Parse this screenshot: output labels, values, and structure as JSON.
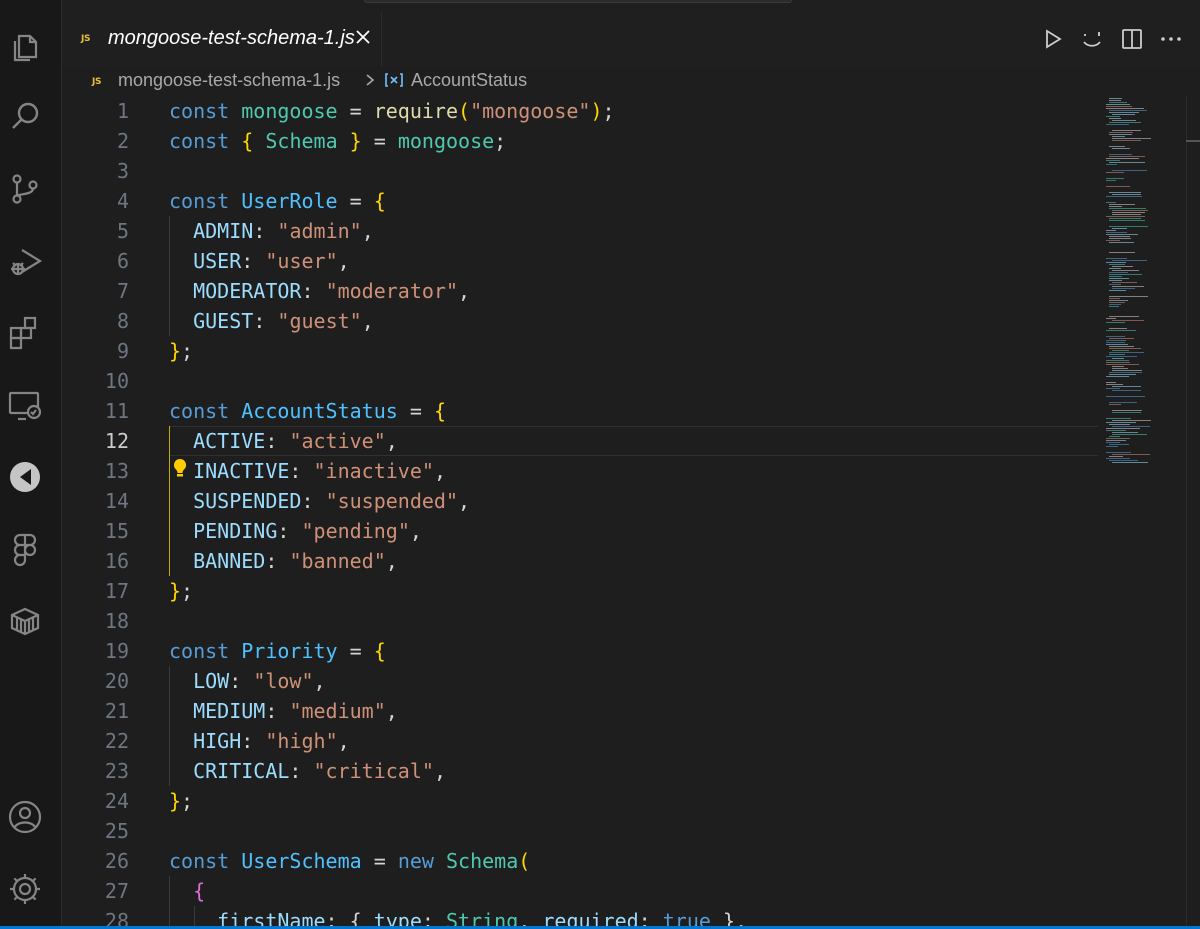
{
  "tab": {
    "file_icon": "JS",
    "title": "mongoose-test-schema-1.js",
    "close_icon": "close-icon"
  },
  "breadcrumb": {
    "file_icon": "JS",
    "file": "mongoose-test-schema-1.js",
    "symbol_icon": "symbol-variable-icon",
    "symbol": "AccountStatus"
  },
  "activity_bar": {
    "items": [
      "explorer-icon",
      "search-icon",
      "source-control-icon",
      "run-debug-icon",
      "extensions-icon",
      "remote-explorer-icon",
      "gitkraken-icon",
      "figma-icon",
      "containers-icon"
    ],
    "bottom": [
      "accounts-icon",
      "manage-gear-icon"
    ]
  },
  "editor_actions": [
    "run-icon",
    "copilot-icon",
    "split-editor-icon",
    "more-actions-icon"
  ],
  "editor": {
    "active_line": 12,
    "lines": [
      {
        "n": "1",
        "t": [
          [
            "kw",
            "const"
          ],
          [
            "p",
            " "
          ],
          [
            "cls",
            "mongoose"
          ],
          [
            "p",
            " = "
          ],
          [
            "fn",
            "require"
          ],
          [
            "b1",
            "("
          ],
          [
            "str",
            "\"mongoose\""
          ],
          [
            "b1",
            ")"
          ],
          [
            "p",
            ";"
          ]
        ]
      },
      {
        "n": "2",
        "t": [
          [
            "kw",
            "const"
          ],
          [
            "p",
            " "
          ],
          [
            "b1",
            "{"
          ],
          [
            "p",
            " "
          ],
          [
            "cls",
            "Schema"
          ],
          [
            "p",
            " "
          ],
          [
            "b1",
            "}"
          ],
          [
            "p",
            " = "
          ],
          [
            "cls",
            "mongoose"
          ],
          [
            "p",
            ";"
          ]
        ]
      },
      {
        "n": "3",
        "t": []
      },
      {
        "n": "4",
        "t": [
          [
            "kw",
            "const"
          ],
          [
            "p",
            " "
          ],
          [
            "var",
            "UserRole"
          ],
          [
            "p",
            " = "
          ],
          [
            "b1",
            "{"
          ]
        ]
      },
      {
        "n": "5",
        "t": [
          [
            "p",
            "  "
          ],
          [
            "prop",
            "ADMIN"
          ],
          [
            "p",
            ": "
          ],
          [
            "str",
            "\"admin\""
          ],
          [
            "p",
            ","
          ]
        ]
      },
      {
        "n": "6",
        "t": [
          [
            "p",
            "  "
          ],
          [
            "prop",
            "USER"
          ],
          [
            "p",
            ": "
          ],
          [
            "str",
            "\"user\""
          ],
          [
            "p",
            ","
          ]
        ]
      },
      {
        "n": "7",
        "t": [
          [
            "p",
            "  "
          ],
          [
            "prop",
            "MODERATOR"
          ],
          [
            "p",
            ": "
          ],
          [
            "str",
            "\"moderator\""
          ],
          [
            "p",
            ","
          ]
        ]
      },
      {
        "n": "8",
        "t": [
          [
            "p",
            "  "
          ],
          [
            "prop",
            "GUEST"
          ],
          [
            "p",
            ": "
          ],
          [
            "str",
            "\"guest\""
          ],
          [
            "p",
            ","
          ]
        ]
      },
      {
        "n": "9",
        "t": [
          [
            "b1",
            "}"
          ],
          [
            "p",
            ";"
          ]
        ]
      },
      {
        "n": "10",
        "t": []
      },
      {
        "n": "11",
        "t": [
          [
            "kw",
            "const"
          ],
          [
            "p",
            " "
          ],
          [
            "var",
            "AccountStatus"
          ],
          [
            "p",
            " = "
          ],
          [
            "b1",
            "{"
          ]
        ]
      },
      {
        "n": "12",
        "t": [
          [
            "p",
            "  "
          ],
          [
            "prop",
            "ACTIVE"
          ],
          [
            "p",
            ": "
          ],
          [
            "str",
            "\"active\""
          ],
          [
            "p",
            ","
          ]
        ]
      },
      {
        "n": "13",
        "t": [
          [
            "p",
            "  "
          ],
          [
            "prop",
            "INACTIVE"
          ],
          [
            "p",
            ": "
          ],
          [
            "str",
            "\"inactive\""
          ],
          [
            "p",
            ","
          ]
        ]
      },
      {
        "n": "14",
        "t": [
          [
            "p",
            "  "
          ],
          [
            "prop",
            "SUSPENDED"
          ],
          [
            "p",
            ": "
          ],
          [
            "str",
            "\"suspended\""
          ],
          [
            "p",
            ","
          ]
        ]
      },
      {
        "n": "15",
        "t": [
          [
            "p",
            "  "
          ],
          [
            "prop",
            "PENDING"
          ],
          [
            "p",
            ": "
          ],
          [
            "str",
            "\"pending\""
          ],
          [
            "p",
            ","
          ]
        ]
      },
      {
        "n": "16",
        "t": [
          [
            "p",
            "  "
          ],
          [
            "prop",
            "BANNED"
          ],
          [
            "p",
            ": "
          ],
          [
            "str",
            "\"banned\""
          ],
          [
            "p",
            ","
          ]
        ]
      },
      {
        "n": "17",
        "t": [
          [
            "b1",
            "}"
          ],
          [
            "p",
            ";"
          ]
        ]
      },
      {
        "n": "18",
        "t": []
      },
      {
        "n": "19",
        "t": [
          [
            "kw",
            "const"
          ],
          [
            "p",
            " "
          ],
          [
            "var",
            "Priority"
          ],
          [
            "p",
            " = "
          ],
          [
            "b1",
            "{"
          ]
        ]
      },
      {
        "n": "20",
        "t": [
          [
            "p",
            "  "
          ],
          [
            "prop",
            "LOW"
          ],
          [
            "p",
            ": "
          ],
          [
            "str",
            "\"low\""
          ],
          [
            "p",
            ","
          ]
        ]
      },
      {
        "n": "21",
        "t": [
          [
            "p",
            "  "
          ],
          [
            "prop",
            "MEDIUM"
          ],
          [
            "p",
            ": "
          ],
          [
            "str",
            "\"medium\""
          ],
          [
            "p",
            ","
          ]
        ]
      },
      {
        "n": "22",
        "t": [
          [
            "p",
            "  "
          ],
          [
            "prop",
            "HIGH"
          ],
          [
            "p",
            ": "
          ],
          [
            "str",
            "\"high\""
          ],
          [
            "p",
            ","
          ]
        ]
      },
      {
        "n": "23",
        "t": [
          [
            "p",
            "  "
          ],
          [
            "prop",
            "CRITICAL"
          ],
          [
            "p",
            ": "
          ],
          [
            "str",
            "\"critical\""
          ],
          [
            "p",
            ","
          ]
        ]
      },
      {
        "n": "24",
        "t": [
          [
            "b1",
            "}"
          ],
          [
            "p",
            ";"
          ]
        ]
      },
      {
        "n": "25",
        "t": []
      },
      {
        "n": "26",
        "t": [
          [
            "kw",
            "const"
          ],
          [
            "p",
            " "
          ],
          [
            "var",
            "UserSchema"
          ],
          [
            "p",
            " = "
          ],
          [
            "kw",
            "new"
          ],
          [
            "p",
            " "
          ],
          [
            "cls",
            "Schema"
          ],
          [
            "b1",
            "("
          ]
        ]
      },
      {
        "n": "27",
        "t": [
          [
            "p",
            "  "
          ],
          [
            "b2",
            "{"
          ]
        ]
      },
      {
        "n": "28",
        "t": [
          [
            "p",
            "    "
          ],
          [
            "prop",
            "firstName"
          ],
          [
            "p",
            ": { "
          ],
          [
            "prop",
            "type"
          ],
          [
            "p",
            ": "
          ],
          [
            "cls",
            "String"
          ],
          [
            "p",
            ", "
          ],
          [
            "prop",
            "required"
          ],
          [
            "p",
            ": "
          ],
          [
            "kw",
            "true"
          ],
          [
            "p",
            " },"
          ]
        ]
      }
    ]
  },
  "colors": {
    "editor_bg": "#1e1e1e",
    "activity_bg": "#181818",
    "keyword": "#569cd6",
    "string": "#ce9178",
    "property": "#9cdcfe",
    "type": "#4ec9b0",
    "bracket": "#ffd700",
    "status_accent": "#0078d4"
  }
}
